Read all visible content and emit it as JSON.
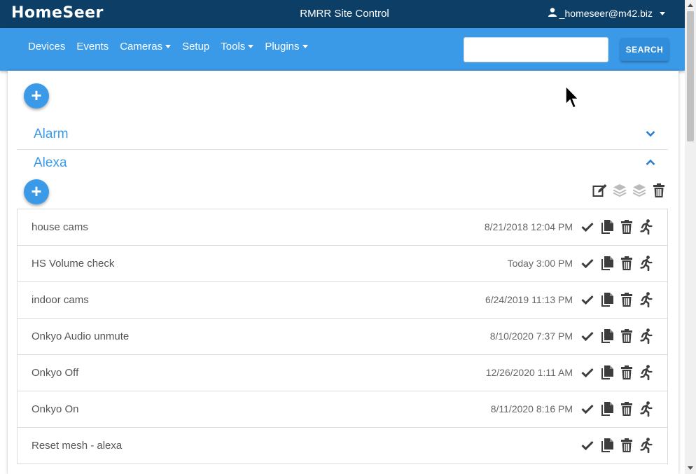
{
  "header": {
    "logo": "HomeSeer",
    "site_title": "RMRR Site Control",
    "user": "_homeseer@m42.biz"
  },
  "nav": {
    "items": [
      {
        "label": "Devices",
        "dropdown": false
      },
      {
        "label": "Events",
        "dropdown": false
      },
      {
        "label": "Cameras",
        "dropdown": true
      },
      {
        "label": "Setup",
        "dropdown": false
      },
      {
        "label": "Tools",
        "dropdown": true
      },
      {
        "label": "Plugins",
        "dropdown": true
      }
    ],
    "search_value": "",
    "search_button": "SEARCH"
  },
  "groups": [
    {
      "title": "Alarm",
      "expanded": false
    },
    {
      "title": "Alexa",
      "expanded": true
    }
  ],
  "events": [
    {
      "name": "house cams",
      "time": "8/21/2018 12:04 PM"
    },
    {
      "name": "HS Volume check",
      "time": "Today 3:00 PM"
    },
    {
      "name": "indoor cams",
      "time": "6/24/2019 11:13 PM"
    },
    {
      "name": "Onkyo Audio unmute",
      "time": "8/10/2020 7:37 PM"
    },
    {
      "name": "Onkyo Off",
      "time": "12/26/2020 1:11 AM"
    },
    {
      "name": "Onkyo On",
      "time": "8/11/2020 8:16 PM"
    },
    {
      "name": "Reset mesh - alexa",
      "time": ""
    }
  ],
  "colors": {
    "topbar": "#0c3e66",
    "navbar": "#3a9ae8",
    "accent": "#3a9ae8",
    "icon": "#3d3d3d"
  }
}
